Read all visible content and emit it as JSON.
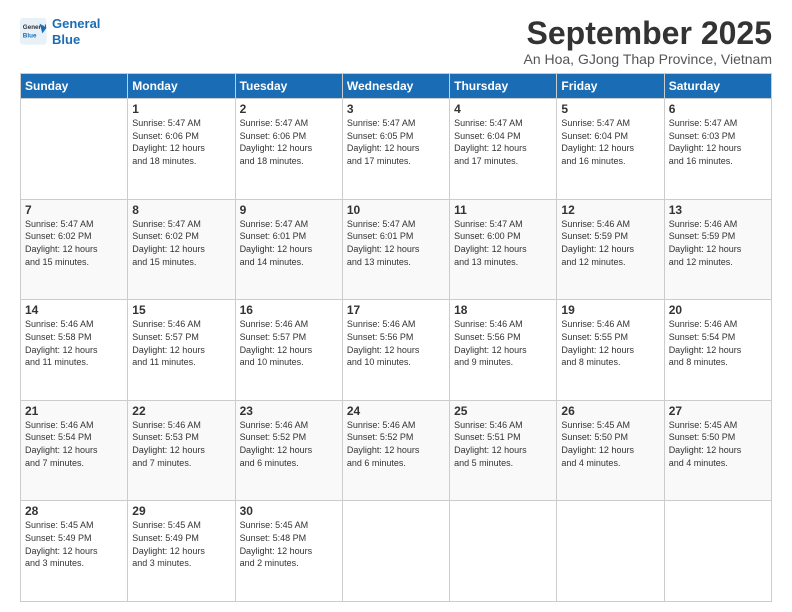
{
  "logo": {
    "line1": "General",
    "line2": "Blue"
  },
  "header": {
    "title": "September 2025",
    "subtitle": "An Hoa, GJong Thap Province, Vietnam"
  },
  "weekdays": [
    "Sunday",
    "Monday",
    "Tuesday",
    "Wednesday",
    "Thursday",
    "Friday",
    "Saturday"
  ],
  "weeks": [
    [
      {
        "day": "",
        "info": ""
      },
      {
        "day": "1",
        "info": "Sunrise: 5:47 AM\nSunset: 6:06 PM\nDaylight: 12 hours\nand 18 minutes."
      },
      {
        "day": "2",
        "info": "Sunrise: 5:47 AM\nSunset: 6:06 PM\nDaylight: 12 hours\nand 18 minutes."
      },
      {
        "day": "3",
        "info": "Sunrise: 5:47 AM\nSunset: 6:05 PM\nDaylight: 12 hours\nand 17 minutes."
      },
      {
        "day": "4",
        "info": "Sunrise: 5:47 AM\nSunset: 6:04 PM\nDaylight: 12 hours\nand 17 minutes."
      },
      {
        "day": "5",
        "info": "Sunrise: 5:47 AM\nSunset: 6:04 PM\nDaylight: 12 hours\nand 16 minutes."
      },
      {
        "day": "6",
        "info": "Sunrise: 5:47 AM\nSunset: 6:03 PM\nDaylight: 12 hours\nand 16 minutes."
      }
    ],
    [
      {
        "day": "7",
        "info": "Sunrise: 5:47 AM\nSunset: 6:02 PM\nDaylight: 12 hours\nand 15 minutes."
      },
      {
        "day": "8",
        "info": "Sunrise: 5:47 AM\nSunset: 6:02 PM\nDaylight: 12 hours\nand 15 minutes."
      },
      {
        "day": "9",
        "info": "Sunrise: 5:47 AM\nSunset: 6:01 PM\nDaylight: 12 hours\nand 14 minutes."
      },
      {
        "day": "10",
        "info": "Sunrise: 5:47 AM\nSunset: 6:01 PM\nDaylight: 12 hours\nand 13 minutes."
      },
      {
        "day": "11",
        "info": "Sunrise: 5:47 AM\nSunset: 6:00 PM\nDaylight: 12 hours\nand 13 minutes."
      },
      {
        "day": "12",
        "info": "Sunrise: 5:46 AM\nSunset: 5:59 PM\nDaylight: 12 hours\nand 12 minutes."
      },
      {
        "day": "13",
        "info": "Sunrise: 5:46 AM\nSunset: 5:59 PM\nDaylight: 12 hours\nand 12 minutes."
      }
    ],
    [
      {
        "day": "14",
        "info": "Sunrise: 5:46 AM\nSunset: 5:58 PM\nDaylight: 12 hours\nand 11 minutes."
      },
      {
        "day": "15",
        "info": "Sunrise: 5:46 AM\nSunset: 5:57 PM\nDaylight: 12 hours\nand 11 minutes."
      },
      {
        "day": "16",
        "info": "Sunrise: 5:46 AM\nSunset: 5:57 PM\nDaylight: 12 hours\nand 10 minutes."
      },
      {
        "day": "17",
        "info": "Sunrise: 5:46 AM\nSunset: 5:56 PM\nDaylight: 12 hours\nand 10 minutes."
      },
      {
        "day": "18",
        "info": "Sunrise: 5:46 AM\nSunset: 5:56 PM\nDaylight: 12 hours\nand 9 minutes."
      },
      {
        "day": "19",
        "info": "Sunrise: 5:46 AM\nSunset: 5:55 PM\nDaylight: 12 hours\nand 8 minutes."
      },
      {
        "day": "20",
        "info": "Sunrise: 5:46 AM\nSunset: 5:54 PM\nDaylight: 12 hours\nand 8 minutes."
      }
    ],
    [
      {
        "day": "21",
        "info": "Sunrise: 5:46 AM\nSunset: 5:54 PM\nDaylight: 12 hours\nand 7 minutes."
      },
      {
        "day": "22",
        "info": "Sunrise: 5:46 AM\nSunset: 5:53 PM\nDaylight: 12 hours\nand 7 minutes."
      },
      {
        "day": "23",
        "info": "Sunrise: 5:46 AM\nSunset: 5:52 PM\nDaylight: 12 hours\nand 6 minutes."
      },
      {
        "day": "24",
        "info": "Sunrise: 5:46 AM\nSunset: 5:52 PM\nDaylight: 12 hours\nand 6 minutes."
      },
      {
        "day": "25",
        "info": "Sunrise: 5:46 AM\nSunset: 5:51 PM\nDaylight: 12 hours\nand 5 minutes."
      },
      {
        "day": "26",
        "info": "Sunrise: 5:45 AM\nSunset: 5:50 PM\nDaylight: 12 hours\nand 4 minutes."
      },
      {
        "day": "27",
        "info": "Sunrise: 5:45 AM\nSunset: 5:50 PM\nDaylight: 12 hours\nand 4 minutes."
      }
    ],
    [
      {
        "day": "28",
        "info": "Sunrise: 5:45 AM\nSunset: 5:49 PM\nDaylight: 12 hours\nand 3 minutes."
      },
      {
        "day": "29",
        "info": "Sunrise: 5:45 AM\nSunset: 5:49 PM\nDaylight: 12 hours\nand 3 minutes."
      },
      {
        "day": "30",
        "info": "Sunrise: 5:45 AM\nSunset: 5:48 PM\nDaylight: 12 hours\nand 2 minutes."
      },
      {
        "day": "",
        "info": ""
      },
      {
        "day": "",
        "info": ""
      },
      {
        "day": "",
        "info": ""
      },
      {
        "day": "",
        "info": ""
      }
    ]
  ]
}
